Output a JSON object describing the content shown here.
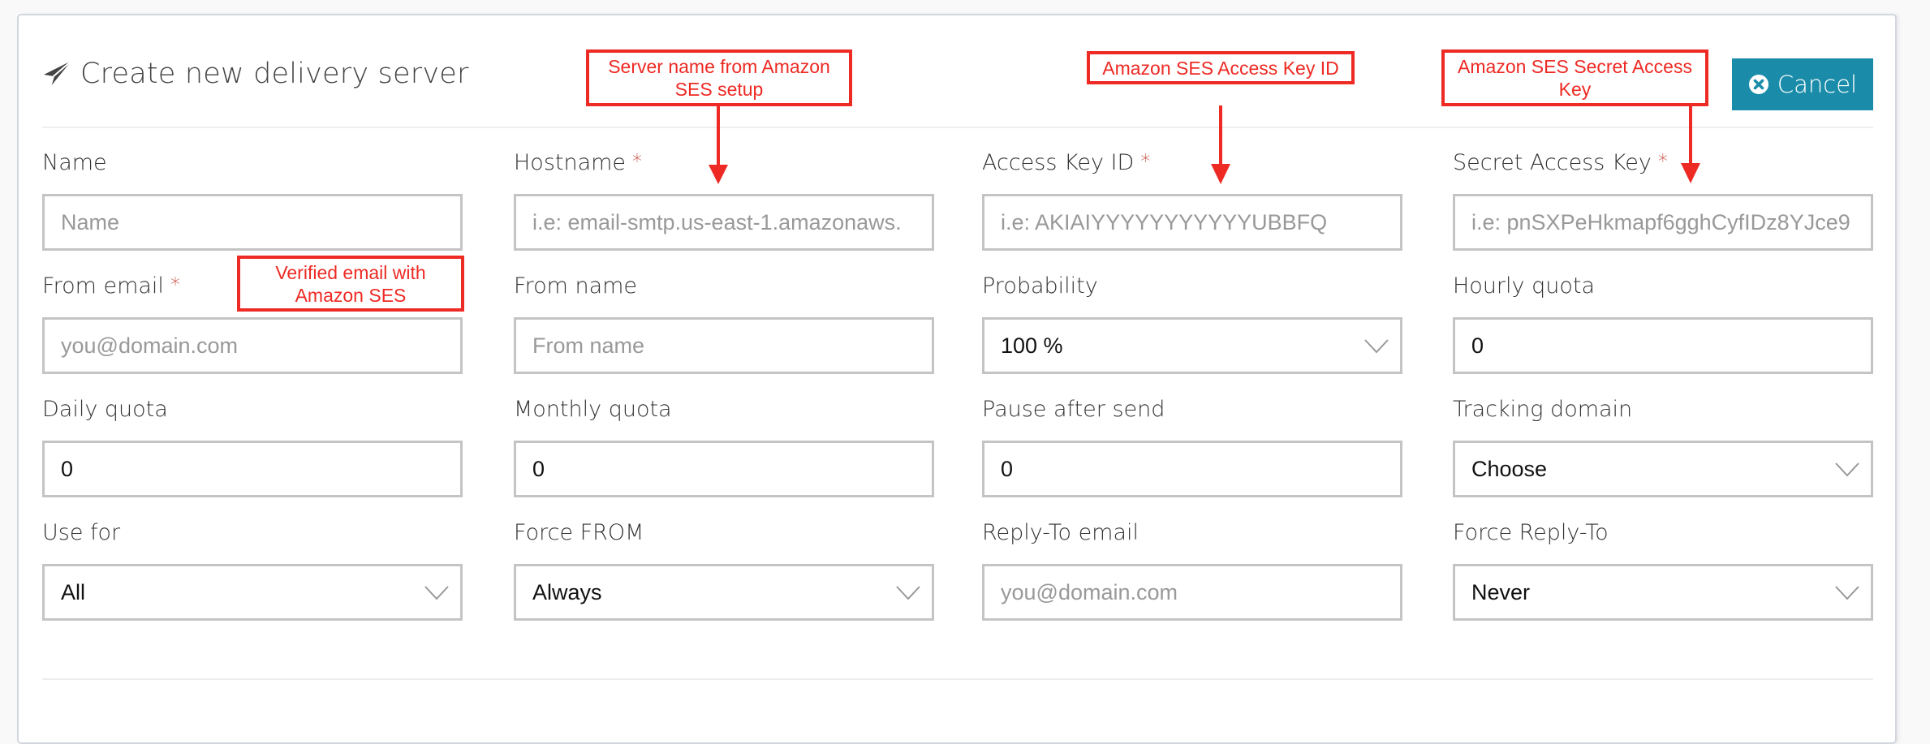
{
  "header": {
    "title": "Create new delivery server",
    "title_icon": "paper-plane-icon",
    "cancel_label": "Cancel",
    "cancel_icon": "times-circle-icon",
    "accent_color": "#1a8ca9"
  },
  "fields": {
    "name": {
      "label": "Name",
      "required": false,
      "value": "",
      "placeholder": "Name",
      "type": "text"
    },
    "hostname": {
      "label": "Hostname",
      "required": true,
      "value": "",
      "placeholder": "i.e: email-smtp.us-east-1.amazonaws.",
      "type": "text"
    },
    "access_key_id": {
      "label": "Access Key ID",
      "required": true,
      "value": "",
      "placeholder": "i.e: AKIAIYYYYYYYYYYYUBBFQ",
      "type": "text"
    },
    "secret_access_key": {
      "label": "Secret Access Key",
      "required": true,
      "value": "",
      "placeholder": "i.e: pnSXPeHkmapf6gghCyfIDz8YJce9",
      "type": "text"
    },
    "from_email": {
      "label": "From email",
      "required": true,
      "value": "",
      "placeholder": "you@domain.com",
      "type": "text"
    },
    "from_name": {
      "label": "From name",
      "required": false,
      "value": "",
      "placeholder": "From name",
      "type": "text"
    },
    "probability": {
      "label": "Probability",
      "required": false,
      "value": "100 %",
      "type": "select"
    },
    "hourly_quota": {
      "label": "Hourly quota",
      "required": false,
      "value": "0",
      "type": "text"
    },
    "daily_quota": {
      "label": "Daily quota",
      "required": false,
      "value": "0",
      "type": "text"
    },
    "monthly_quota": {
      "label": "Monthly quota",
      "required": false,
      "value": "0",
      "type": "text"
    },
    "pause_after_send": {
      "label": "Pause after send",
      "required": false,
      "value": "0",
      "type": "text"
    },
    "tracking_domain": {
      "label": "Tracking domain",
      "required": false,
      "value": "Choose",
      "type": "select"
    },
    "use_for": {
      "label": "Use for",
      "required": false,
      "value": "All",
      "type": "select"
    },
    "force_from": {
      "label": "Force FROM",
      "required": false,
      "value": "Always",
      "type": "select"
    },
    "reply_to_email": {
      "label": "Reply-To email",
      "required": false,
      "value": "",
      "placeholder": "you@domain.com",
      "type": "text"
    },
    "force_reply_to": {
      "label": "Force Reply-To",
      "required": false,
      "value": "Never",
      "type": "select"
    }
  },
  "required_marker": "*",
  "annotations": {
    "hostname": "Server name from Amazon SES setup",
    "access_key_id": "Amazon SES Access Key ID",
    "secret_access_key": "Amazon SES Secret Access Key",
    "from_email": "Verified email with Amazon SES",
    "color": "#ee2a24"
  }
}
